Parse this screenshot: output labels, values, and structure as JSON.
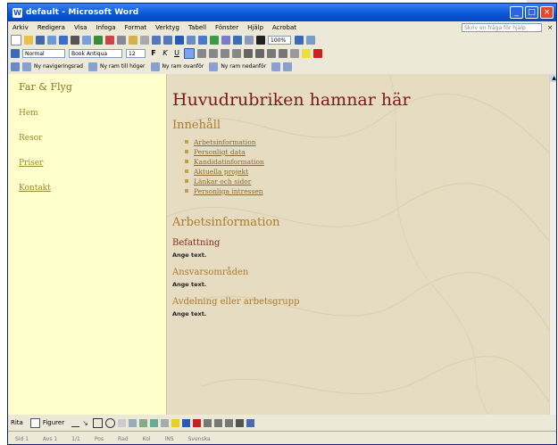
{
  "window": {
    "title": "default - Microsoft Word"
  },
  "menu": [
    "Arkiv",
    "Redigera",
    "Visa",
    "Infoga",
    "Format",
    "Verktyg",
    "Tabell",
    "Fönster",
    "Hjälp",
    "Acrobat"
  ],
  "help_box": "Skriv en fråga för hjälp",
  "formatting": {
    "style": "Normal",
    "font": "Book Antiqua",
    "size": "12",
    "zoom": "100%"
  },
  "web_toolbar": [
    "Ny navigeringsrad",
    "Ny ram till höger",
    "Ny ram ovanför",
    "Ny ram nedanför"
  ],
  "left_frame": {
    "brand": "Far & Flyg",
    "nav": [
      "Hem",
      "Resor",
      "Priser",
      "Kontakt"
    ]
  },
  "main": {
    "heading": "Huvudrubriken hamnar här",
    "toc_title": "Innehåll",
    "toc": [
      "Arbetsinformation",
      "Personligt data",
      "Kandidatinformation",
      "Aktuella projekt",
      "Länkar och sidor",
      "Personliga intressen"
    ],
    "section_title": "Arbetsinformation",
    "subsections": [
      {
        "title": "Befattning",
        "text": "Ange text."
      },
      {
        "title": "Ansvarsområden",
        "text": "Ange text."
      },
      {
        "title": "Avdelning eller arbetsgrupp",
        "text": "Ange text."
      }
    ]
  },
  "drawing_toolbar": {
    "draw_label": "Rita",
    "autoshapes_label": "Figurer"
  },
  "status_bar": [
    "Sid 1",
    "Avs 1",
    "1/1",
    "Pos",
    "Rad",
    "Kol",
    "INS",
    "Svenska"
  ],
  "colors": {
    "title_blue": "#0a58d8",
    "left_bg": "#ffffcc",
    "main_bg": "#e5dcc2",
    "heading": "#7a1a1a",
    "subheading": "#b07a28"
  }
}
